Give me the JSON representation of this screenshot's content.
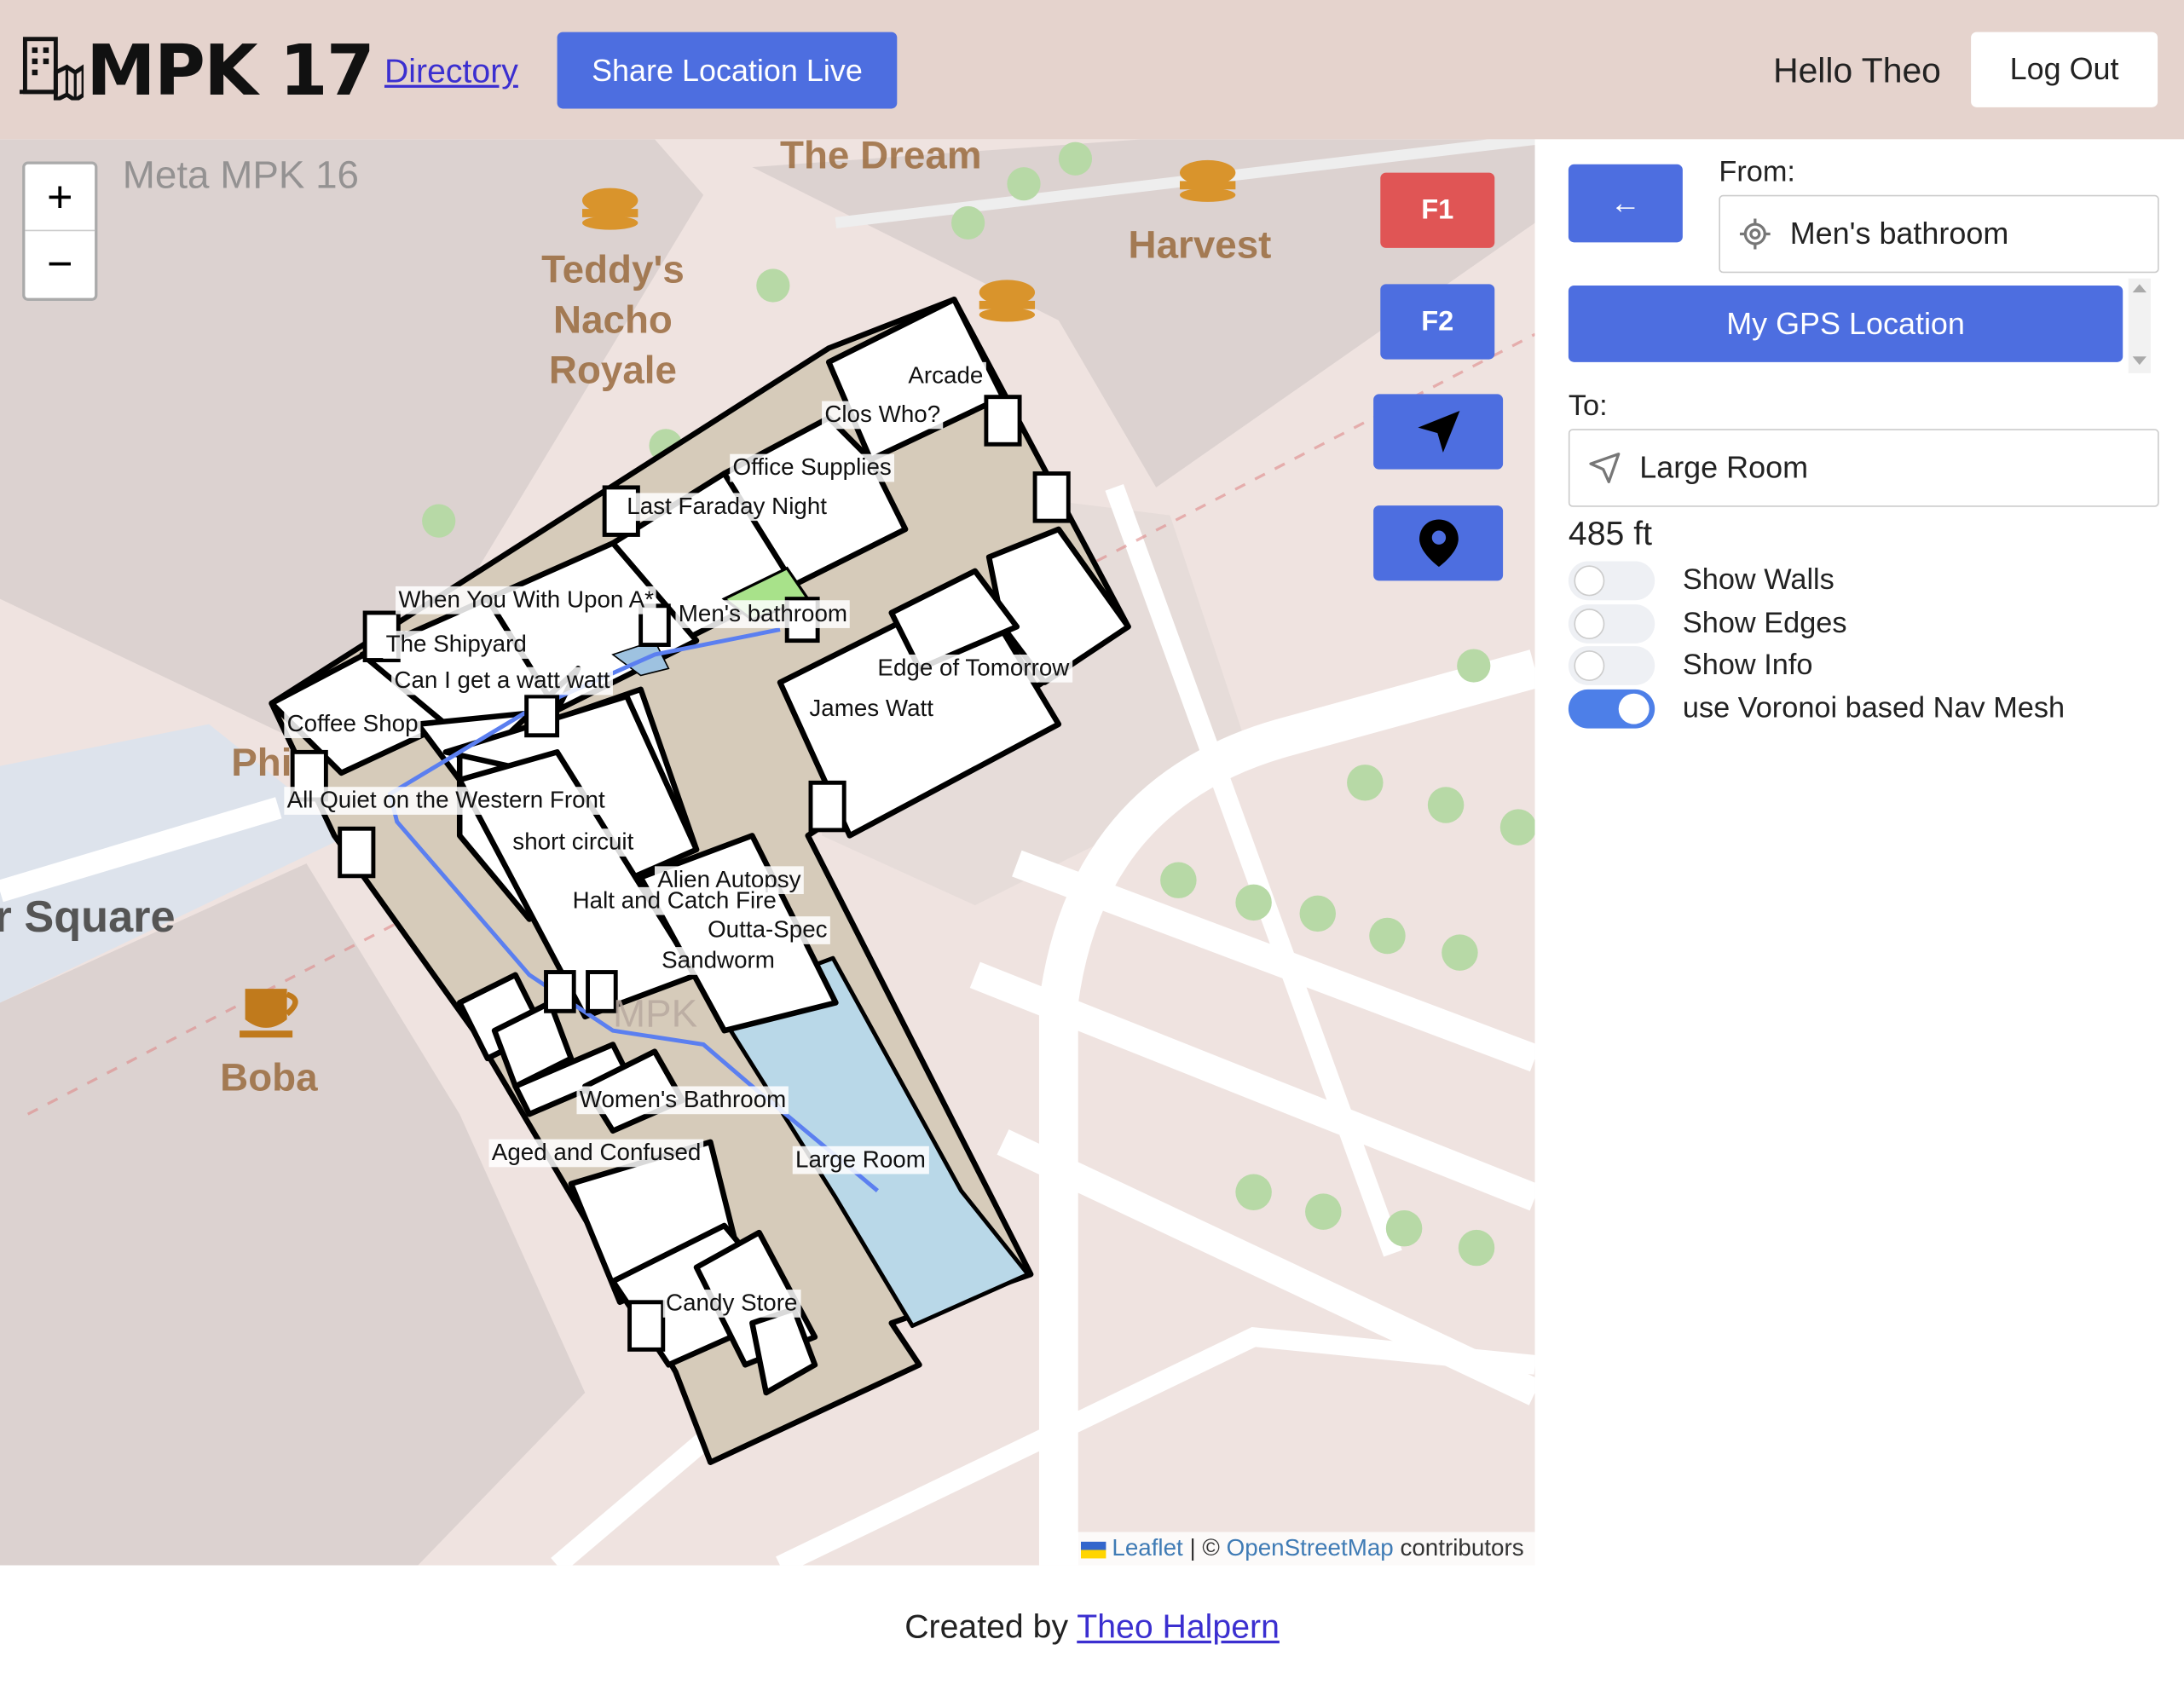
{
  "header": {
    "brand": "MPK 17",
    "directory_link": "Directory",
    "share_button": "Share Location Live",
    "greeting": "Hello Theo",
    "logout_button": "Log Out"
  },
  "map": {
    "zoom_in": "+",
    "zoom_out": "−",
    "floors": [
      {
        "label": "F1",
        "color": "#e05555"
      },
      {
        "label": "F2",
        "color": "#4d6ee0"
      }
    ],
    "tools": [
      "navigation-arrow-icon",
      "map-pin-icon"
    ],
    "poi_labels": {
      "meta": "Meta MPK 16",
      "teddys": "Teddy's Nacho Royale",
      "dream": "The Dream",
      "harvest": "Harvest",
      "boba": "Boba",
      "square": "r Square",
      "phil": "Phi",
      "mpk_faint": "MPK"
    },
    "room_labels": {
      "arcade": "Arcade",
      "clos_who": "Clos Who?",
      "office_supplies": "Office Supplies",
      "last_faraday": "Last Faraday Night",
      "when_you_wish": "When You With Upon A*",
      "mens_bathroom": "Men's bathroom",
      "shipyard": "The Shipyard",
      "can_i_watt": "Can I get a watt watt",
      "coffee_shop": "Coffee Shop",
      "edge_of_tomorrow": "Edge of Tomorrow",
      "james_watt": "James Watt",
      "all_quiet": "All Quiet on the Western Front",
      "short_circuit": "short circuit",
      "alien_autopsy": "Alien Autopsy",
      "halt_catch_fire": "Halt and Catch Fire",
      "outta_spec": "Outta-Spec",
      "sandworm": "Sandworm",
      "womens_bathroom": "Women's Bathroom",
      "aged_confused": "Aged and Confused",
      "large_room": "Large Room",
      "candy_store": "Candy Store"
    },
    "attribution": {
      "leaflet": "Leaflet",
      "sep": " | © ",
      "osm": "OpenStreetMap",
      "contributors": " contributors"
    }
  },
  "panel": {
    "back_button": "←",
    "from_label": "From:",
    "from_value": "Men's bathroom",
    "gps_button": "My GPS Location",
    "to_label": "To:",
    "to_value": "Large Room",
    "distance": "485 ft",
    "toggles": [
      {
        "label": "Show Walls",
        "on": false
      },
      {
        "label": "Show Edges",
        "on": false
      },
      {
        "label": "Show Info",
        "on": false
      },
      {
        "label": "use Voronoi based Nav Mesh",
        "on": true
      }
    ]
  },
  "footer": {
    "created_by": "Created by ",
    "author": "Theo Halpern"
  },
  "colors": {
    "accent": "#4d6ee0",
    "header_bg": "#e5d3cd",
    "route": "#5b7ff0",
    "large_room": "#b9d8e8",
    "corridor": "#d6cbba"
  }
}
